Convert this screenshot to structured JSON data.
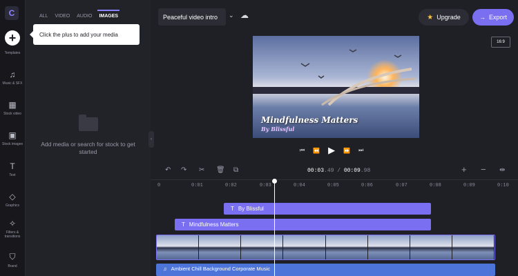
{
  "sidebar": {
    "logo": "C",
    "plus_symbol": "+",
    "items": [
      {
        "label": "Templates",
        "icon": "templates-icon",
        "glyph": ""
      },
      {
        "label": "Music & SFX",
        "icon": "music-icon",
        "glyph": "♫"
      },
      {
        "label": "Stock video",
        "icon": "film-icon",
        "glyph": "▦"
      },
      {
        "label": "Stock images",
        "icon": "image-icon",
        "glyph": "▣"
      },
      {
        "label": "Text",
        "icon": "text-icon",
        "glyph": "T"
      },
      {
        "label": "Graphics",
        "icon": "shapes-icon",
        "glyph": "◇"
      },
      {
        "label": "Filters & transitions",
        "icon": "sparkle-icon",
        "glyph": "✧"
      },
      {
        "label": "Brand",
        "icon": "shield-icon",
        "glyph": "⛉"
      }
    ]
  },
  "media_panel": {
    "tabs": [
      "ALL",
      "VIDEO",
      "AUDIO",
      "IMAGES"
    ],
    "active_tab": "IMAGES",
    "tooltip": "Click the plus to add your media",
    "empty_text": "Add media or search for stock to get started"
  },
  "header": {
    "project_title": "Peaceful video intro",
    "upgrade_label": "Upgrade",
    "export_label": "Export",
    "aspect_ratio": "16:9"
  },
  "preview": {
    "title_text": "Mindfulness Matters",
    "subtitle_text": "By Blissful"
  },
  "timeline": {
    "current_time_bold": "00:03",
    "current_time_frac": ".49",
    "separator": " / ",
    "total_time_bold": "00:09",
    "total_time_frac": ".98",
    "ruler_ticks": [
      "0",
      "0:01",
      "0:02",
      "0:03",
      "0:04",
      "0:05",
      "0:06",
      "0:07",
      "0:08",
      "0:09",
      "0:10"
    ],
    "text_clips": [
      {
        "label": "By Blissful"
      },
      {
        "label": "Mindfulness Matters"
      }
    ],
    "audio_clip": "Ambient Chill Background Corporate Music",
    "video_frames": 8,
    "playhead_time": 3.49
  },
  "colors": {
    "accent": "#7a6ff0",
    "audio": "#4d74d8",
    "background": "#1f1f26"
  }
}
